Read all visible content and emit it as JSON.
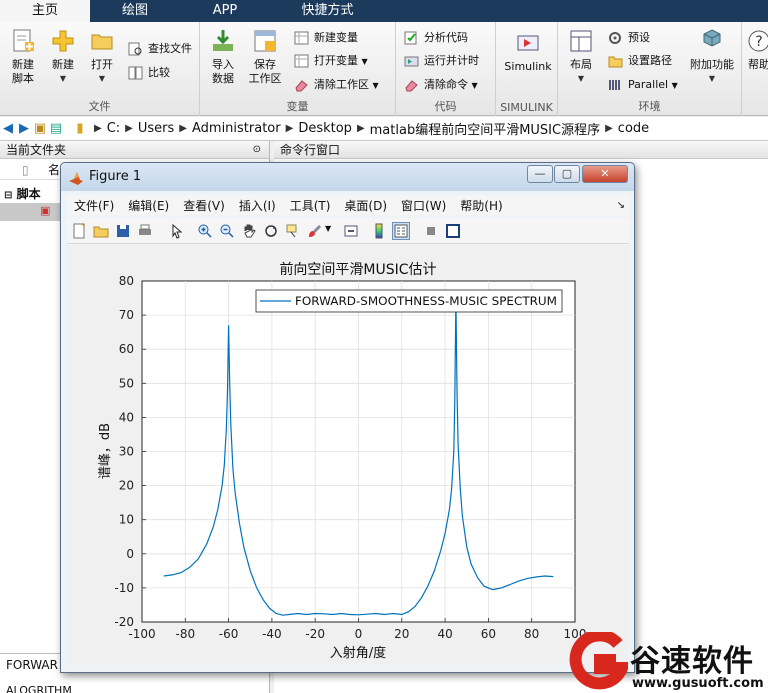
{
  "tabs": [
    {
      "label": "主页",
      "active": true
    },
    {
      "label": "绘图",
      "active": false
    },
    {
      "label": "APP",
      "active": false
    },
    {
      "label": "快捷方式",
      "active": false
    }
  ],
  "ribbon": {
    "file": {
      "label": "文件",
      "new_script": "新建\n脚本",
      "new": "新建",
      "open": "打开",
      "find_files": "查找文件",
      "compare": "比较"
    },
    "variable": {
      "label": "变量",
      "import": "导入\n数据",
      "save_ws": "保存\n工作区",
      "new_var": "新建变量",
      "open_var": "打开变量",
      "clear_ws": "清除工作区"
    },
    "code": {
      "label": "代码",
      "analyze": "分析代码",
      "run_time": "运行并计时",
      "clear_cmd": "清除命令"
    },
    "simulink": {
      "label": "SIMULINK",
      "btn": "Simulink"
    },
    "env": {
      "label": "环境",
      "layout": "布局",
      "prefs": "预设",
      "set_path": "设置路径",
      "parallel": "Parallel",
      "addons": "附加功能",
      "help": "帮助"
    }
  },
  "address": [
    "C:",
    "Users",
    "Administrator",
    "Desktop",
    "matlab编程前向空间平滑MUSIC源程序",
    "code"
  ],
  "left_pane": {
    "title": "当前文件夹",
    "col_name": "名",
    "folder": "脚本",
    "bottom_item": "FORWAR",
    "bottom_item2": "ALOGRITHM"
  },
  "right_pane": {
    "title": "命令行窗口"
  },
  "figure": {
    "title": "Figure 1",
    "menus": [
      "文件(F)",
      "编辑(E)",
      "查看(V)",
      "插入(I)",
      "工具(T)",
      "桌面(D)",
      "窗口(W)",
      "帮助(H)"
    ],
    "btn_min": "—",
    "btn_max": "▢",
    "btn_close": "✕"
  },
  "chart_data": {
    "type": "line",
    "title": "前向空间平滑MUSIC估计",
    "xlabel": "入射角/度",
    "ylabel": "谱峰，dB",
    "xlim": [
      -100,
      100
    ],
    "ylim": [
      -20,
      80
    ],
    "xticks": [
      -100,
      -80,
      -60,
      -40,
      -20,
      0,
      20,
      40,
      60,
      80,
      100
    ],
    "yticks": [
      -20,
      -10,
      0,
      10,
      20,
      30,
      40,
      50,
      60,
      70,
      80
    ],
    "grid": true,
    "legend_position": "top-right",
    "line_color": "#0072bd",
    "series": [
      {
        "name": "FORWARD-SMOOTHNESS-MUSIC SPECTRUM",
        "x": [
          -90,
          -86,
          -82,
          -78,
          -74,
          -70,
          -67,
          -65,
          -63,
          -62,
          -61,
          -60.5,
          -60,
          -59.5,
          -59,
          -58,
          -57,
          -55,
          -53,
          -50,
          -47,
          -44,
          -41,
          -38,
          -35,
          -32,
          -28,
          -24,
          -20,
          -16,
          -12,
          -8,
          -4,
          0,
          4,
          8,
          12,
          16,
          20,
          23,
          26,
          29,
          32,
          35,
          38,
          40,
          42,
          43,
          44,
          44.5,
          45,
          45.5,
          46,
          47,
          48,
          50,
          52,
          55,
          58,
          62,
          66,
          70,
          74,
          78,
          82,
          86,
          90
        ],
        "y": [
          -6.5,
          -6.2,
          -5.5,
          -4,
          -1.5,
          3,
          8,
          13,
          20,
          26,
          37,
          48,
          67,
          50,
          38,
          25,
          18,
          9,
          2,
          -5,
          -10,
          -13.5,
          -16,
          -17.5,
          -18,
          -17.8,
          -17.5,
          -17.8,
          -17.5,
          -17.6,
          -17.8,
          -17.5,
          -17.8,
          -17.9,
          -17.7,
          -17.5,
          -17.8,
          -17.5,
          -17.8,
          -17,
          -15.5,
          -13,
          -9.5,
          -5,
          1,
          6,
          13,
          19,
          30,
          45,
          75,
          48,
          32,
          19,
          11,
          2,
          -3,
          -7,
          -9.5,
          -10.5,
          -10,
          -9,
          -8,
          -7.2,
          -6.8,
          -6.5,
          -6.7
        ]
      }
    ]
  },
  "watermark": {
    "text": "谷速软件",
    "url": "www.gusuoft.com"
  }
}
